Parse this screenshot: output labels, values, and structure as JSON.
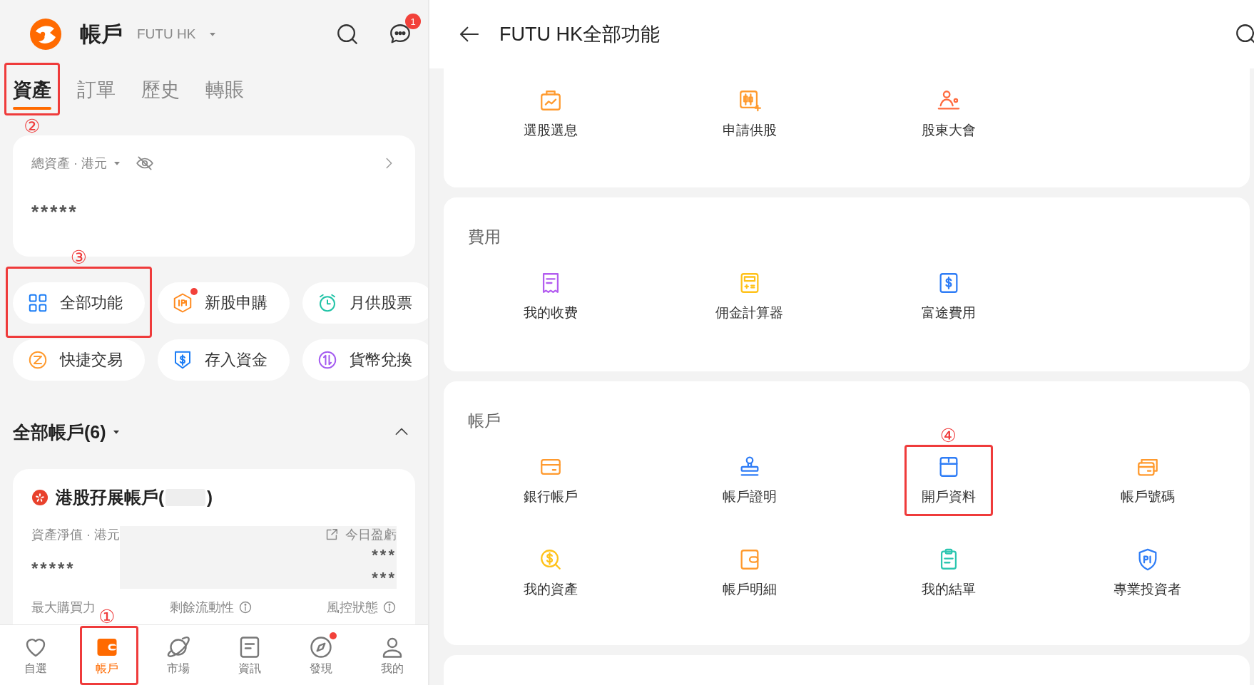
{
  "left_panel": {
    "header": {
      "title": "帳戶",
      "broker": "FUTU HK",
      "message_badge": "1"
    },
    "tabs": [
      {
        "label": "資產",
        "selected": true,
        "marker": "②"
      },
      {
        "label": "訂單",
        "selected": false
      },
      {
        "label": "歷史",
        "selected": false
      },
      {
        "label": "轉賬",
        "selected": false
      }
    ],
    "asset_card": {
      "label": "總資產 · 港元",
      "value": "*****"
    },
    "shortcuts": [
      {
        "label": "全部功能",
        "color": "#1a7cf5",
        "dot": false,
        "marker": "③"
      },
      {
        "label": "新股申購",
        "color": "#ff8a1f",
        "dot": true
      },
      {
        "label": "月供股票",
        "color": "#20c3a6",
        "dot": false
      },
      {
        "label": "快捷交易",
        "color": "#ff9a2e",
        "dot": false
      },
      {
        "label": "存入資金",
        "color": "#1a7cf5",
        "dot": false
      },
      {
        "label": "貨幣兌換",
        "color": "#a45cf0",
        "dot": false
      }
    ],
    "accounts_header": {
      "title": "全部帳戶(6)",
      "expanded": true
    },
    "account_card": {
      "name_prefix": "港股孖展帳戶(",
      "name_suffix": ")",
      "net_label": "資產淨值 · 港元",
      "net_value": "*****",
      "pl_label": "今日盈虧",
      "pl_values": [
        "***",
        "***"
      ],
      "metrics": [
        "最大購買力",
        "剩餘流動性",
        "風控狀態"
      ]
    },
    "bottom_nav": [
      {
        "label": "自選",
        "selected": false,
        "dot": false
      },
      {
        "label": "帳戶",
        "selected": true,
        "dot": false,
        "marker": "①"
      },
      {
        "label": "市場",
        "selected": false,
        "dot": false
      },
      {
        "label": "資訊",
        "selected": false,
        "dot": false
      },
      {
        "label": "發現",
        "selected": false,
        "dot": true
      },
      {
        "label": "我的",
        "selected": false,
        "dot": false
      }
    ]
  },
  "right_panel": {
    "title": "FUTU HK全部功能",
    "sections": [
      {
        "items": [
          {
            "label": "選股選息",
            "color": "#ff9a2e"
          },
          {
            "label": "申請供股",
            "color": "#ff9a2e"
          },
          {
            "label": "股東大會",
            "color": "#ff6a3d"
          }
        ]
      },
      {
        "title": "費用",
        "items": [
          {
            "label": "我的收费",
            "color": "#b35cf0"
          },
          {
            "label": "佣金計算器",
            "color": "#ffc21a"
          },
          {
            "label": "富途費用",
            "color": "#2f7df6"
          }
        ]
      },
      {
        "title": "帳戶",
        "items": [
          {
            "label": "銀行帳戶",
            "color": "#ff9a2e"
          },
          {
            "label": "帳戶證明",
            "color": "#2f7df6"
          },
          {
            "label": "開戶資料",
            "color": "#2f7df6",
            "marker": "④"
          },
          {
            "label": "帳戶號碼",
            "color": "#ff9a2e"
          },
          {
            "label": "我的資產",
            "color": "#ffc21a"
          },
          {
            "label": "帳戶明細",
            "color": "#ff9a2e"
          },
          {
            "label": "我的結單",
            "color": "#2cc6b0"
          },
          {
            "label": "專業投資者",
            "color": "#2f7df6"
          }
        ]
      }
    ]
  }
}
